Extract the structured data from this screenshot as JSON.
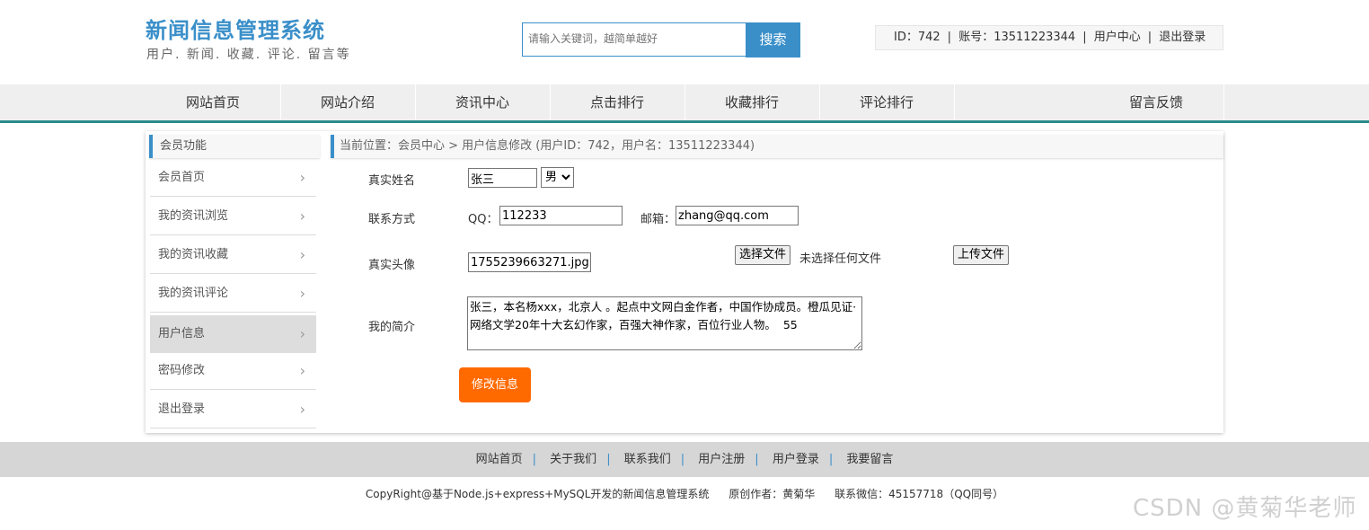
{
  "header": {
    "title": "新闻信息管理系统",
    "subtitle": "用户. 新闻. 收藏. 评论. 留言等",
    "search_placeholder": "请输入关键词，越简单越好",
    "search_button": "搜索",
    "user_id": "ID：742",
    "account": "账号：13511223344",
    "user_center": "用户中心",
    "logout": "退出登录"
  },
  "nav": {
    "items": [
      "网站首页",
      "网站介绍",
      "资讯中心",
      "点击排行",
      "收藏排行",
      "评论排行",
      "留言反馈"
    ]
  },
  "sidebar": {
    "title": "会员功能",
    "items": [
      {
        "label": "会员首页"
      },
      {
        "label": "我的资讯浏览"
      },
      {
        "label": "我的资讯收藏"
      },
      {
        "label": "我的资讯评论"
      },
      {
        "label": "用户信息"
      },
      {
        "label": "密码修改"
      },
      {
        "label": "退出登录"
      }
    ],
    "chevron": "›"
  },
  "breadcrumb": "当前位置：会员中心 > 用户信息修改 (用户ID：742，用户名：13511223344)",
  "form": {
    "name_label": "真实姓名",
    "name_value": "张三",
    "gender_value": "男",
    "contact_label": "联系方式",
    "qq_label": "QQ：",
    "qq_value": "112233",
    "email_label": "邮箱：",
    "email_value": "zhang@qq.com",
    "avatar_label": "真实头像",
    "avatar_value": "1755239663271.jpg",
    "choose_file": "选择文件",
    "no_file": "未选择任何文件",
    "upload": "上传文件",
    "bio_label": "我的简介",
    "bio_value": "张三，本名杨xxx，北京人 。起点中文网白金作者，中国作协成员。橙瓜见证·网络文学20年十大玄幻作家，百强大神作家，百位行业人物。  55",
    "submit": "修改信息"
  },
  "footer": {
    "links": [
      "网站首页",
      "关于我们",
      "联系我们",
      "用户注册",
      "用户登录",
      "我要留言"
    ],
    "copyright": "CopyRight@基于Node.js+express+MySQL开发的新闻信息管理系统",
    "author": "原创作者：黄菊华",
    "contact": "联系微信：45157718（QQ同号）"
  },
  "watermark": "CSDN @黄菊华老师",
  "colors": {
    "brand": "#3a8fc9",
    "accent_button": "#ff6a00",
    "nav_underline": "#2a8a8a"
  }
}
